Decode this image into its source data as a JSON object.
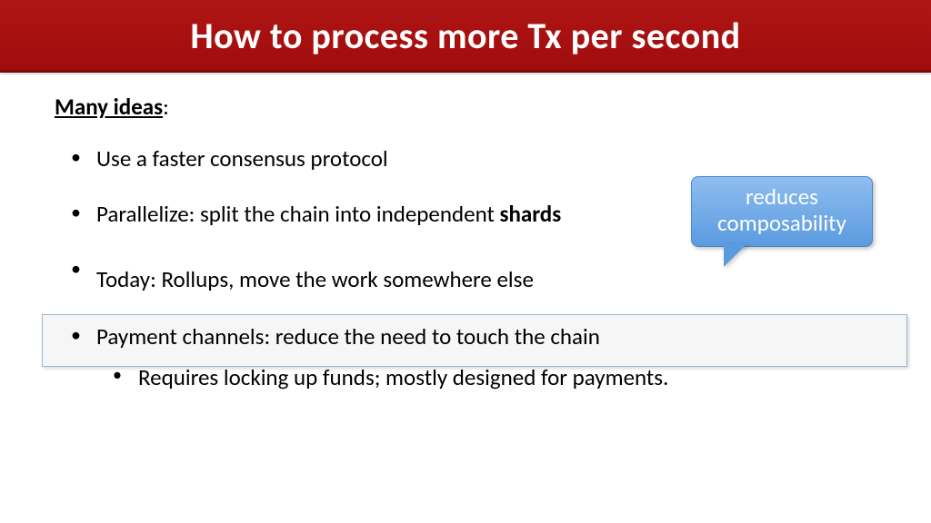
{
  "title": "How to process more Tx per second",
  "lead_label": "Many ideas",
  "lead_suffix": ":",
  "bullets": {
    "b1": "Use a faster consensus protocol",
    "b2_pre": "Parallelize:  split the chain into independent ",
    "b2_bold": "shards",
    "b3": "Today:   Rollups, move the work somewhere else",
    "b4": "Payment channels: reduce the need to touch the chain",
    "b4_sub": "Requires locking up funds; mostly designed for payments."
  },
  "callout": {
    "line1": "reduces",
    "line2": "composability"
  }
}
